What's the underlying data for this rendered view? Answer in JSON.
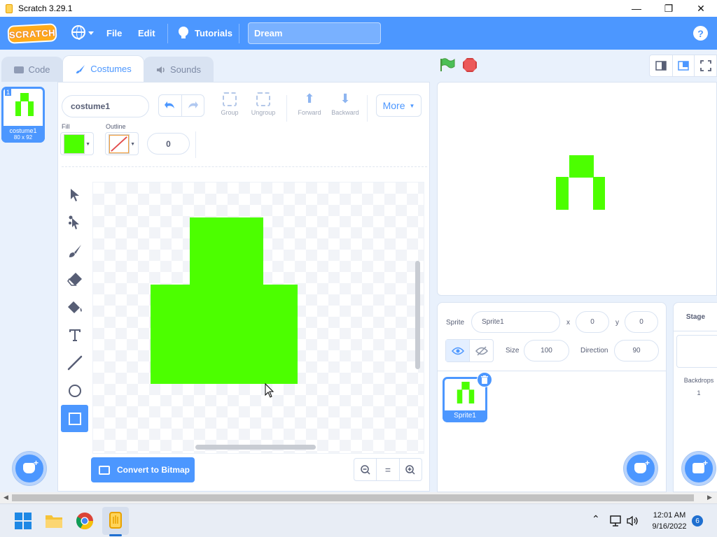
{
  "window": {
    "title": "Scratch 3.29.1",
    "controls": {
      "minimize": "—",
      "maximize": "❐",
      "close": "✕"
    }
  },
  "menubar": {
    "logo": "SCRATCH",
    "file": "File",
    "edit": "Edit",
    "tutorials": "Tutorials",
    "project_title": "Dream",
    "help": "?",
    "color": "#4c97ff"
  },
  "tabs": [
    {
      "label": "Code",
      "icon": "code-icon"
    },
    {
      "label": "Costumes",
      "icon": "brush-icon"
    },
    {
      "label": "Sounds",
      "icon": "speaker-icon"
    }
  ],
  "costume_list": [
    {
      "index": "1",
      "name": "costume1",
      "size": "80 x 92"
    }
  ],
  "paint_editor": {
    "costume_name": "costume1",
    "group": "Group",
    "ungroup": "Ungroup",
    "forward": "Forward",
    "backward": "Backward",
    "more": "More",
    "fill_label": "Fill",
    "outline_label": "Outline",
    "fill_color": "#4cff00",
    "outline_width": "0",
    "convert_button": "Convert to Bitmap",
    "tools": [
      "select-tool",
      "reshape-tool",
      "brush-tool",
      "eraser-tool",
      "fill-tool",
      "text-tool",
      "line-tool",
      "circle-tool",
      "rectangle-tool"
    ],
    "active_tool": "rectangle-tool",
    "zoom": {
      "out": "−",
      "reset": "=",
      "in": "+"
    }
  },
  "sprite_info": {
    "sprite_label": "Sprite",
    "sprite_name": "Sprite1",
    "x_label": "x",
    "x": "0",
    "y_label": "y",
    "y": "0",
    "size_label": "Size",
    "size": "100",
    "direction_label": "Direction",
    "direction": "90"
  },
  "sprites": [
    {
      "name": "Sprite1"
    }
  ],
  "stage_pane": {
    "title": "Stage",
    "backdrops_label": "Backdrops",
    "backdrops_count": "1"
  },
  "taskbar": {
    "time": "12:01 AM",
    "date": "9/16/2022",
    "notifications": "6",
    "apps": [
      "windows-start-icon",
      "file-explorer-icon",
      "chrome-icon",
      "scratch-app-icon"
    ]
  }
}
